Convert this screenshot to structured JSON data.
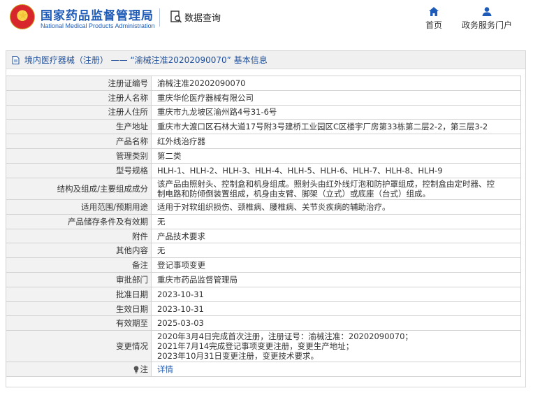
{
  "header": {
    "org_name_cn": "国家药品监督管理局",
    "org_name_en": "National Medical Products Administration",
    "page_title": "数据查询",
    "nav": [
      {
        "label": "首页",
        "icon": "home-icon"
      },
      {
        "label": "政务服务门户",
        "icon": "user-icon"
      }
    ]
  },
  "breadcrumb": {
    "text": "境内医疗器械（注册） —— “渝械注准20202090070” 基本信息"
  },
  "record": {
    "rows": [
      {
        "label": "注册证编号",
        "value": "渝械注准20202090070"
      },
      {
        "label": "注册人名称",
        "value": "重庆华伦医疗器械有限公司"
      },
      {
        "label": "注册人住所",
        "value": "重庆市九龙坡区渝州路4号31-6号"
      },
      {
        "label": "生产地址",
        "value": "重庆市大渡口区石林大道17号附3号建桥工业园区C区楼宇厂房第33栋第二层2-2，第三层3-2"
      },
      {
        "label": "产品名称",
        "value": "红外线治疗器"
      },
      {
        "label": "管理类别",
        "value": "第二类"
      },
      {
        "label": "型号规格",
        "value": "HLH-1、HLH-2、HLH-3、HLH-4、HLH-5、HLH-6、HLH-7、HLH-8、HLH-9"
      },
      {
        "label": "结构及组成/主要组成成分",
        "lines": [
          "该产品由照射头、控制盒和机身组成。照射头由红外线灯泡和防护罩组成，控制盒由定时器、控",
          "制电路和防倾倒装置组成，机身由支臂、脚架（立式）或底座（台式）组成。"
        ]
      },
      {
        "label": "适用范围/预期用途",
        "value": "适用于对软组织损伤、颈椎病、腰椎病、关节炎疾病的辅助治疗。"
      },
      {
        "label": "产品储存条件及有效期",
        "value": "无"
      },
      {
        "label": "附件",
        "value": "产品技术要求"
      },
      {
        "label": "其他内容",
        "value": "无"
      },
      {
        "label": "备注",
        "value": "登记事项变更"
      },
      {
        "label": "审批部门",
        "value": "重庆市药品监督管理局"
      },
      {
        "label": "批准日期",
        "value": "2023-10-31"
      },
      {
        "label": "生效日期",
        "value": "2023-10-31"
      },
      {
        "label": "有效期至",
        "value": "2025-03-03"
      },
      {
        "label": "变更情况",
        "lines": [
          "2020年3月4日完成首次注册，注册证号：渝械注准：20202090070；",
          "2021年7月14完成登记事项变更注册，变更生产地址；",
          "2023年10月31日变更注册，变更技术要求。"
        ]
      },
      {
        "label": "注",
        "value": "详情",
        "icon": "lightbulb-icon"
      }
    ]
  },
  "colors": {
    "brand_blue": "#1e5bb8",
    "label_bg": "#f2f2f2",
    "border": "#d2d2d2"
  }
}
